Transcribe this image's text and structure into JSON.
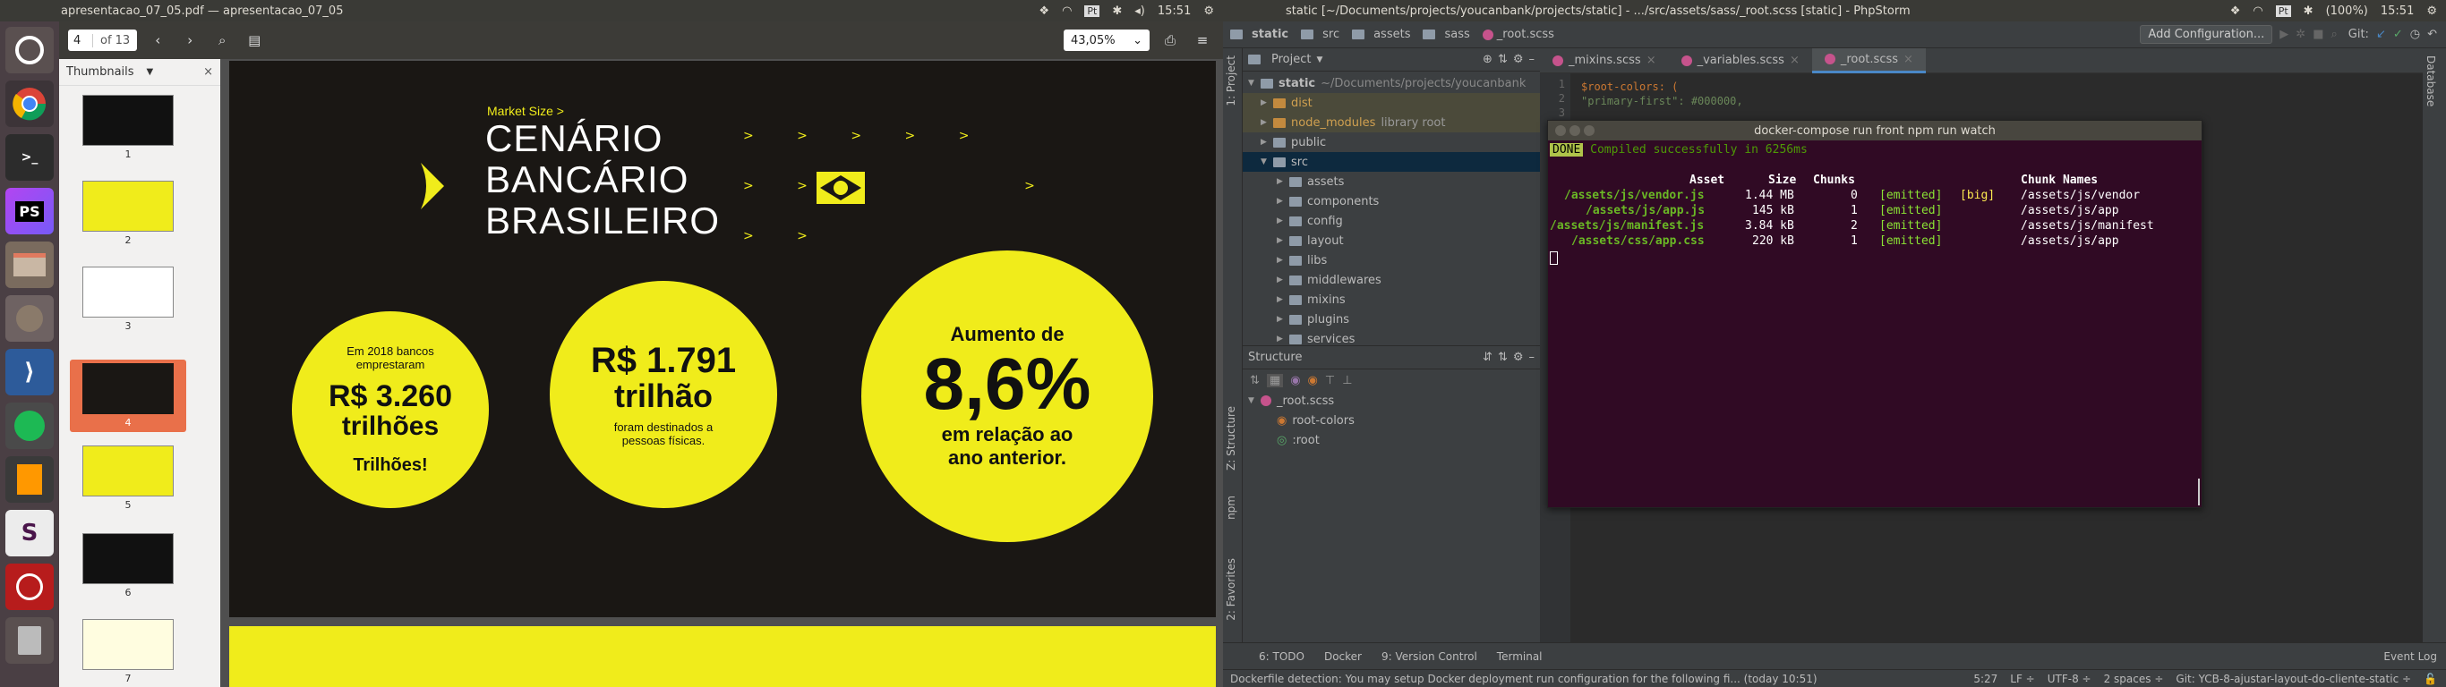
{
  "left": {
    "topbar": {
      "title": "apresentacao_07_05.pdf — apresentacao_07_05",
      "time": "15:51",
      "battery": "(100%)"
    },
    "toolbar": {
      "page_current": "4",
      "page_total": "of 13",
      "zoom": "43,05%"
    },
    "sidebar": {
      "title": "Thumbnails"
    },
    "thumbnails": [
      {
        "num": "1"
      },
      {
        "num": "2"
      },
      {
        "num": "3"
      },
      {
        "num": "4"
      },
      {
        "num": "5"
      },
      {
        "num": "6"
      },
      {
        "num": "7"
      }
    ],
    "slide": {
      "kicker": "Market Size >",
      "title_1": "CENÁRIO",
      "title_2": "BANCÁRIO",
      "title_3": "BRASILEIRO",
      "c1_top": "Em 2018 bancos",
      "c1_top2": "emprestaram",
      "c1_big": "R$ 3.260",
      "c1_big2": "trilhões",
      "c1_bottom": "Trilhões!",
      "c2_big": "R$ 1.791",
      "c2_big2": "trilhão",
      "c2_small": "foram destinados a",
      "c2_small2": "pessoas físicas.",
      "c3_top": "Aumento de",
      "c3_big": "8,6%",
      "c3_bottom": "em relação ao",
      "c3_bottom2": "ano anterior."
    },
    "launcher": [
      "PS"
    ]
  },
  "right": {
    "topbar": {
      "title": "static [~/Documents/projects/youcanbank/projects/static] - .../src/assets/sass/_root.scss [static] - PhpStorm",
      "time": "15:51",
      "battery": "(100%)"
    },
    "breadcrumbs": [
      "static",
      "src",
      "assets",
      "sass",
      "_root.scss"
    ],
    "add_config": "Add Configuration...",
    "git_label": "Git:",
    "project": {
      "title": "Project",
      "root_name": "static",
      "root_path": "~/Documents/projects/youcanbank",
      "items": [
        {
          "label": "dist",
          "level": 1,
          "open": false
        },
        {
          "label": "node_modules",
          "extra": "library root",
          "level": 1,
          "open": false
        },
        {
          "label": "public",
          "level": 1,
          "open": false
        },
        {
          "label": "src",
          "level": 1,
          "open": true
        },
        {
          "label": "assets",
          "level": 2,
          "open": false
        },
        {
          "label": "components",
          "level": 2,
          "open": false
        },
        {
          "label": "config",
          "level": 2,
          "open": false
        },
        {
          "label": "layout",
          "level": 2,
          "open": false
        },
        {
          "label": "libs",
          "level": 2,
          "open": false
        },
        {
          "label": "middlewares",
          "level": 2,
          "open": false
        },
        {
          "label": "mixins",
          "level": 2,
          "open": false
        },
        {
          "label": "plugins",
          "level": 2,
          "open": false
        },
        {
          "label": "services",
          "level": 2,
          "open": false
        }
      ]
    },
    "structure": {
      "title": "Structure",
      "file": "_root.scss",
      "items": [
        "root-colors",
        ":root"
      ]
    },
    "tabs": [
      "_mixins.scss",
      "_variables.scss",
      "_root.scss"
    ],
    "code": {
      "line1": "$root-colors: (",
      "line2": "  \"primary-first\": #000000,"
    },
    "terminal": {
      "title": "docker-compose run front npm run watch",
      "done": "DONE",
      "compiled": "Compiled successfully in 6256ms",
      "headers": [
        "Asset",
        "Size",
        "Chunks",
        "Chunk Names"
      ],
      "rows": [
        {
          "asset": "/assets/js/vendor.js",
          "size": "1.44 MB",
          "chunks": "0",
          "emitted": "[emitted]",
          "big": "[big]",
          "name": "/assets/js/vendor"
        },
        {
          "asset": "/assets/js/app.js",
          "size": "145 kB",
          "chunks": "1",
          "emitted": "[emitted]",
          "big": "",
          "name": "/assets/js/app"
        },
        {
          "asset": "/assets/js/manifest.js",
          "size": "3.84 kB",
          "chunks": "2",
          "emitted": "[emitted]",
          "big": "",
          "name": "/assets/js/manifest"
        },
        {
          "asset": "/assets/css/app.css",
          "size": "220 kB",
          "chunks": "1",
          "emitted": "[emitted]",
          "big": "",
          "name": "/assets/js/app"
        }
      ]
    },
    "side_tabs": [
      "1: Project",
      "Z: Structure",
      "npm",
      "2: Favorites"
    ],
    "right_tab": "Database",
    "bottom_tabs": [
      "6: TODO",
      "Docker",
      "9: Version Control",
      "Terminal"
    ],
    "event_log": "Event Log",
    "status": {
      "message": "Dockerfile detection: You may setup Docker deployment run configuration for the following fi... (today 10:51)",
      "pos": "5:27",
      "lf": "LF ÷",
      "enc": "UTF-8 ÷",
      "indent": "2 spaces ÷",
      "git": "Git: YCB-8-ajustar-layout-do-cliente-static ÷"
    }
  }
}
